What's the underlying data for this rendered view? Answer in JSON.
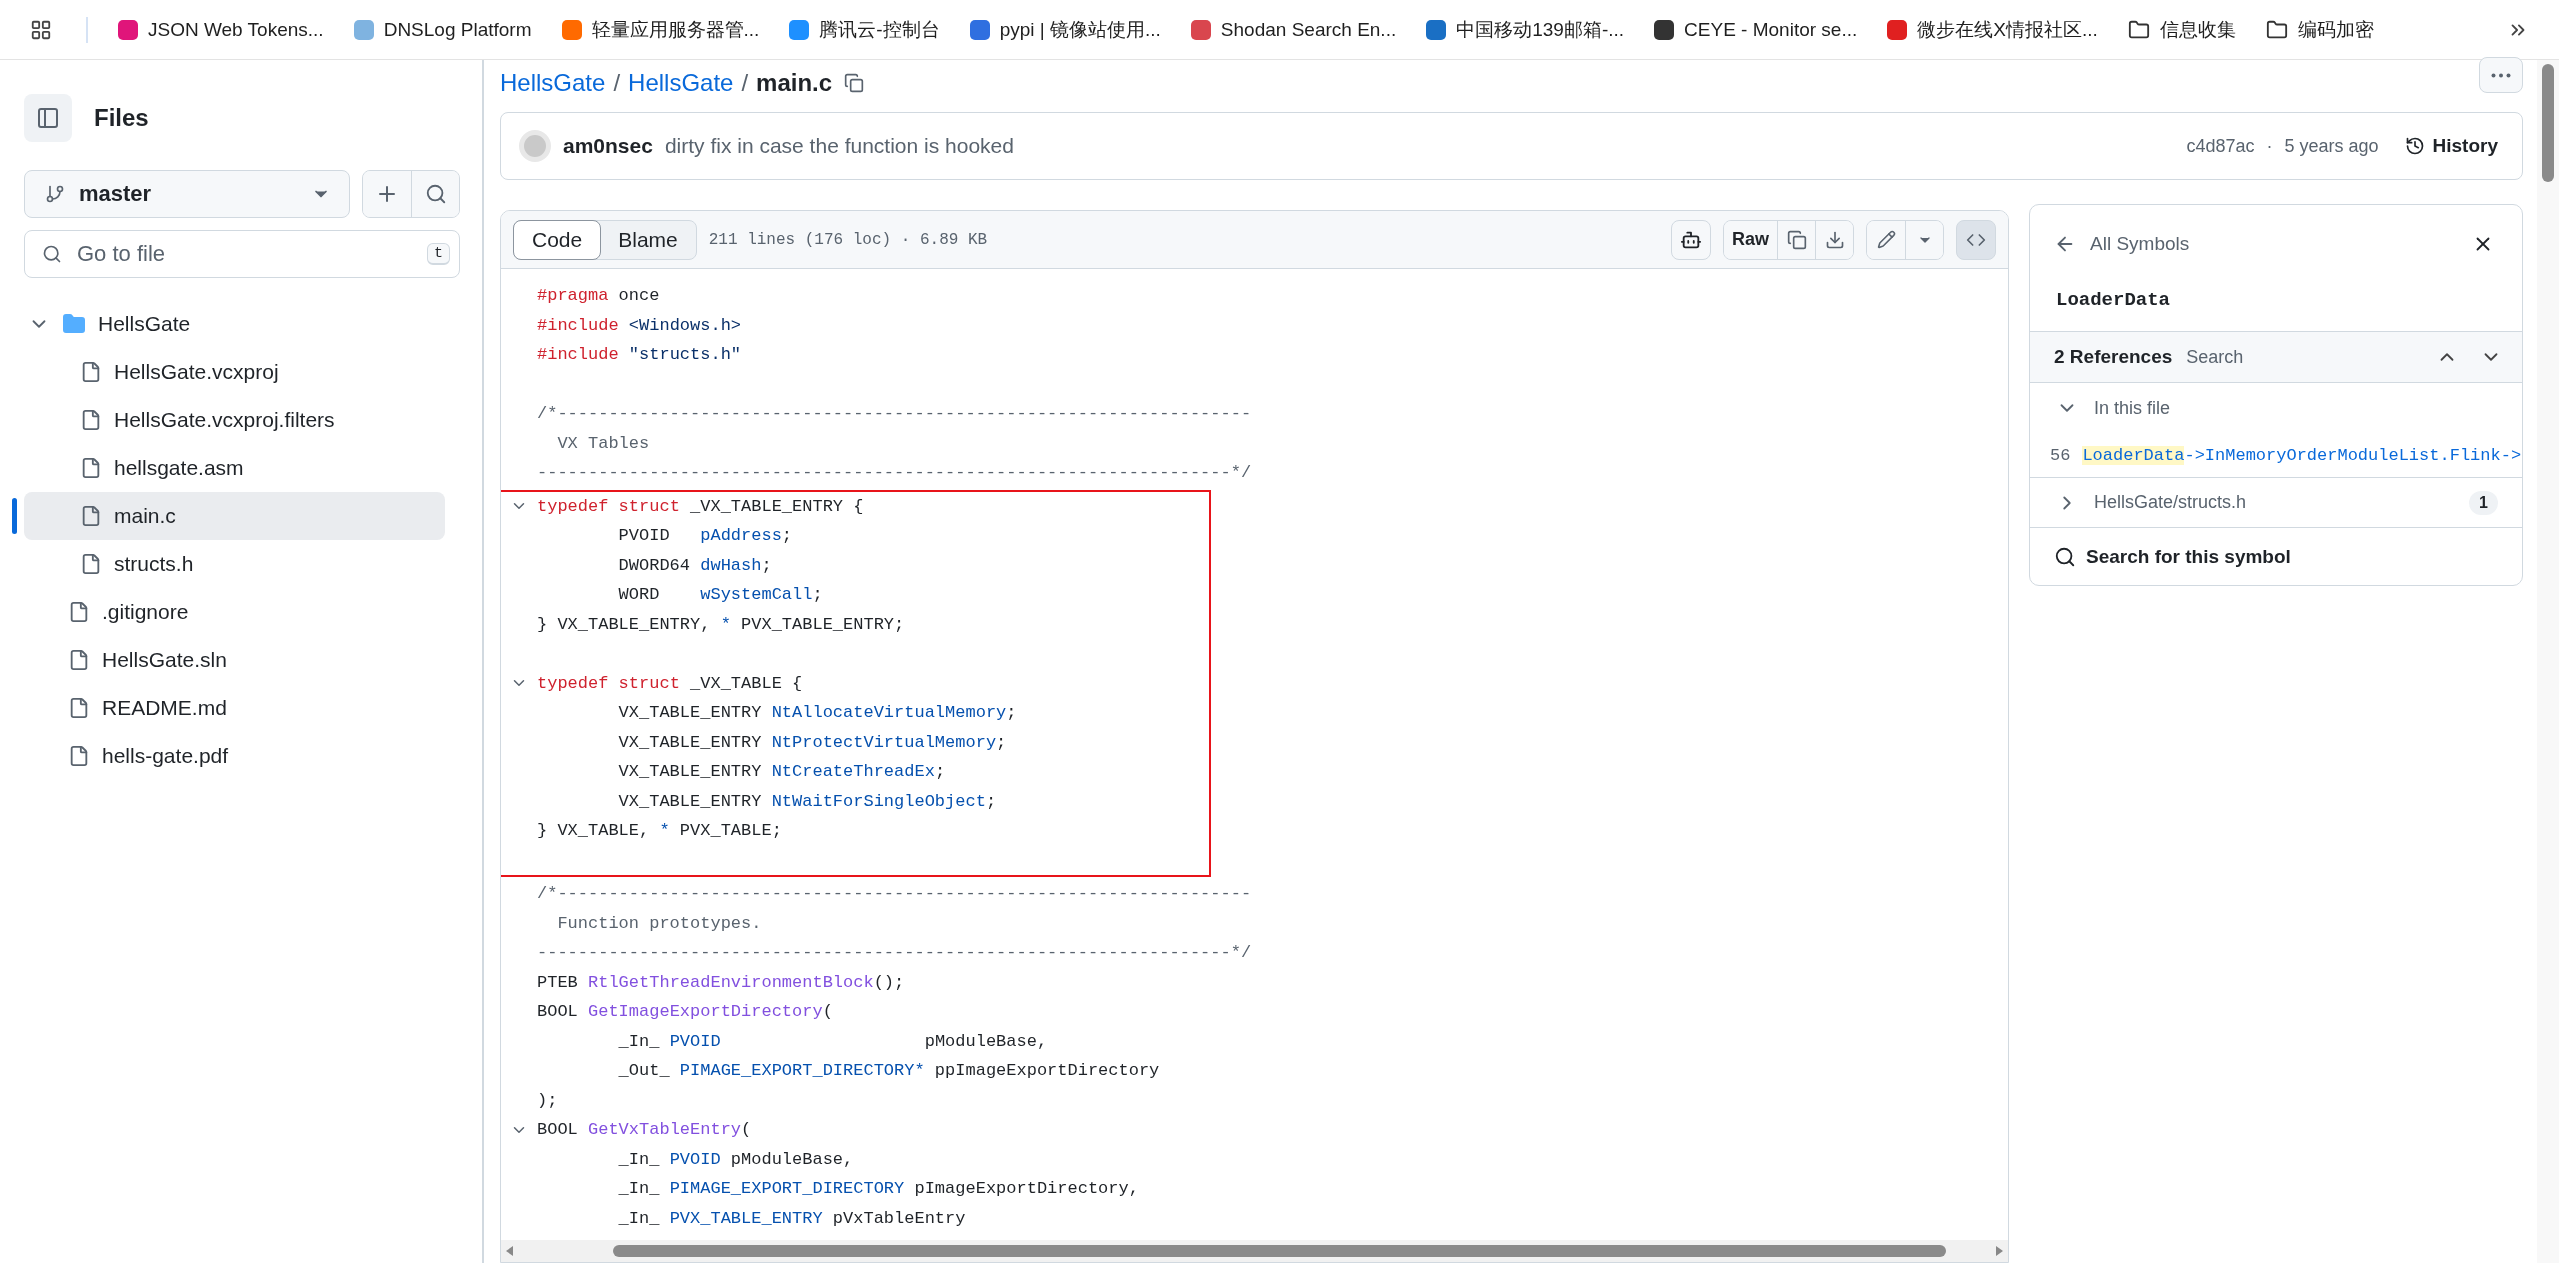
{
  "bookmarks": [
    {
      "kind": "site",
      "label": "JSON Web Tokens...",
      "color": "#e0157a"
    },
    {
      "kind": "site",
      "label": "DNSLog Platform",
      "color": "#7fb3e0"
    },
    {
      "kind": "site",
      "label": "轻量应用服务器管...",
      "color": "#ff6a00"
    },
    {
      "kind": "site",
      "label": "腾讯云-控制台",
      "color": "#1e90ff"
    },
    {
      "kind": "site",
      "label": "pypi | 镜像站使用...",
      "color": "#2f6fe0"
    },
    {
      "kind": "site",
      "label": "Shodan Search En...",
      "color": "#d9464e"
    },
    {
      "kind": "site",
      "label": "中国移动139邮箱-...",
      "color": "#1a6fc4"
    },
    {
      "kind": "site",
      "label": "CEYE - Monitor se...",
      "color": "#333333"
    },
    {
      "kind": "site",
      "label": "微步在线X情报社区...",
      "color": "#e02020"
    },
    {
      "kind": "folder",
      "label": "信息收集"
    },
    {
      "kind": "folder",
      "label": "编码加密"
    }
  ],
  "sidebar": {
    "title": "Files",
    "branch": "master",
    "search": {
      "placeholder": "Go to file",
      "shortcut": "t"
    },
    "tree": [
      {
        "kind": "folder",
        "label": "HellsGate",
        "expanded": true,
        "selected": false,
        "children": [
          {
            "kind": "file",
            "label": "HellsGate.vcxproj",
            "selected": false
          },
          {
            "kind": "file",
            "label": "HellsGate.vcxproj.filters",
            "selected": false
          },
          {
            "kind": "file",
            "label": "hellsgate.asm",
            "selected": false
          },
          {
            "kind": "file",
            "label": "main.c",
            "selected": true
          },
          {
            "kind": "file",
            "label": "structs.h",
            "selected": false
          }
        ]
      },
      {
        "kind": "file",
        "label": ".gitignore",
        "selected": false
      },
      {
        "kind": "file",
        "label": "HellsGate.sln",
        "selected": false
      },
      {
        "kind": "file",
        "label": "README.md",
        "selected": false
      },
      {
        "kind": "file",
        "label": "hells-gate.pdf",
        "selected": false
      }
    ]
  },
  "breadcrumb": [
    {
      "kind": "link",
      "text": "HellsGate"
    },
    {
      "kind": "sep",
      "text": "/"
    },
    {
      "kind": "link",
      "text": "HellsGate"
    },
    {
      "kind": "sep",
      "text": "/"
    },
    {
      "kind": "current",
      "text": "main.c"
    }
  ],
  "commit": {
    "author": "am0nsec",
    "message": "dirty fix in case the function is hooked",
    "sha": "c4d87ac",
    "separator": "·",
    "time": "5 years ago",
    "history": "History"
  },
  "file_header": {
    "tabs": [
      {
        "label": "Code",
        "selected": true
      },
      {
        "label": "Blame",
        "selected": false
      }
    ],
    "info": "211 lines (176 loc) · 6.89 KB",
    "raw": "Raw",
    "symbols_open": true
  },
  "code_blocks": [
    {
      "highlighted": false,
      "lines": [
        {
          "kind": "plain",
          "tokens": [
            {
              "kind": "kw",
              "text": "#pragma"
            },
            {
              "kind": "plain",
              "text": " once"
            }
          ]
        },
        {
          "kind": "plain",
          "tokens": [
            {
              "kind": "kw",
              "text": "#include"
            },
            {
              "kind": "str",
              "text": " <Windows.h>"
            }
          ]
        },
        {
          "kind": "plain",
          "tokens": [
            {
              "kind": "kw",
              "text": "#include"
            },
            {
              "kind": "str",
              "text": " \"structs.h\""
            }
          ]
        },
        {
          "kind": "blank"
        },
        {
          "kind": "plain",
          "tokens": [
            {
              "kind": "comment",
              "text": "/*--------------------------------------------------------------------"
            }
          ]
        },
        {
          "kind": "plain",
          "tokens": [
            {
              "kind": "comment",
              "text": "  VX Tables"
            }
          ]
        },
        {
          "kind": "plain",
          "tokens": [
            {
              "kind": "comment",
              "text": "--------------------------------------------------------------------*/"
            }
          ]
        }
      ]
    },
    {
      "highlighted": true,
      "lines": [
        {
          "kind": "fold",
          "tokens": [
            {
              "kind": "kw",
              "text": "typedef"
            },
            {
              "kind": "kw",
              "text": " struct"
            },
            {
              "kind": "plain",
              "text": " _VX_TABLE_ENTRY {"
            }
          ]
        },
        {
          "kind": "plain",
          "tokens": [
            {
              "kind": "plain",
              "text": "        PVOID   "
            },
            {
              "kind": "entity",
              "text": "pAddress"
            },
            {
              "kind": "plain",
              "text": ";"
            }
          ]
        },
        {
          "kind": "plain",
          "tokens": [
            {
              "kind": "plain",
              "text": "        DWORD64 "
            },
            {
              "kind": "entity",
              "text": "dwHash"
            },
            {
              "kind": "plain",
              "text": ";"
            }
          ]
        },
        {
          "kind": "plain",
          "tokens": [
            {
              "kind": "plain",
              "text": "        WORD    "
            },
            {
              "kind": "entity",
              "text": "wSystemCall"
            },
            {
              "kind": "plain",
              "text": ";"
            }
          ]
        },
        {
          "kind": "plain",
          "tokens": [
            {
              "kind": "plain",
              "text": "} VX_TABLE_ENTRY, "
            },
            {
              "kind": "entity",
              "text": "*"
            },
            {
              "kind": "plain",
              "text": " PVX_TABLE_ENTRY;"
            }
          ]
        },
        {
          "kind": "blank"
        },
        {
          "kind": "fold",
          "tokens": [
            {
              "kind": "kw",
              "text": "typedef"
            },
            {
              "kind": "kw",
              "text": " struct"
            },
            {
              "kind": "plain",
              "text": " _VX_TABLE {"
            }
          ]
        },
        {
          "kind": "plain",
          "tokens": [
            {
              "kind": "plain",
              "text": "        VX_TABLE_ENTRY "
            },
            {
              "kind": "entity",
              "text": "NtAllocateVirtualMemory"
            },
            {
              "kind": "plain",
              "text": ";"
            }
          ]
        },
        {
          "kind": "plain",
          "tokens": [
            {
              "kind": "plain",
              "text": "        VX_TABLE_ENTRY "
            },
            {
              "kind": "entity",
              "text": "NtProtectVirtualMemory"
            },
            {
              "kind": "plain",
              "text": ";"
            }
          ]
        },
        {
          "kind": "plain",
          "tokens": [
            {
              "kind": "plain",
              "text": "        VX_TABLE_ENTRY "
            },
            {
              "kind": "entity",
              "text": "NtCreateThreadEx"
            },
            {
              "kind": "plain",
              "text": ";"
            }
          ]
        },
        {
          "kind": "plain",
          "tokens": [
            {
              "kind": "plain",
              "text": "        VX_TABLE_ENTRY "
            },
            {
              "kind": "entity",
              "text": "NtWaitForSingleObject"
            },
            {
              "kind": "plain",
              "text": ";"
            }
          ]
        },
        {
          "kind": "plain",
          "tokens": [
            {
              "kind": "plain",
              "text": "} VX_TABLE, "
            },
            {
              "kind": "entity",
              "text": "*"
            },
            {
              "kind": "plain",
              "text": " PVX_TABLE;"
            }
          ]
        },
        {
          "kind": "blank"
        }
      ]
    },
    {
      "highlighted": false,
      "lines": [
        {
          "kind": "plain",
          "tokens": [
            {
              "kind": "comment",
              "text": "/*--------------------------------------------------------------------"
            }
          ]
        },
        {
          "kind": "plain",
          "tokens": [
            {
              "kind": "comment",
              "text": "  Function prototypes."
            }
          ]
        },
        {
          "kind": "plain",
          "tokens": [
            {
              "kind": "comment",
              "text": "--------------------------------------------------------------------*/"
            }
          ]
        },
        {
          "kind": "plain",
          "tokens": [
            {
              "kind": "plain",
              "text": "PTEB "
            },
            {
              "kind": "func",
              "text": "RtlGetThreadEnvironmentBlock"
            },
            {
              "kind": "plain",
              "text": "();"
            }
          ]
        },
        {
          "kind": "plain",
          "tokens": [
            {
              "kind": "plain",
              "text": "BOOL "
            },
            {
              "kind": "func",
              "text": "GetImageExportDirectory"
            },
            {
              "kind": "plain",
              "text": "("
            }
          ]
        },
        {
          "kind": "plain",
          "tokens": [
            {
              "kind": "plain",
              "text": "        _In_ "
            },
            {
              "kind": "entity",
              "text": "PVOID"
            },
            {
              "kind": "plain",
              "text": "                    pModuleBase,"
            }
          ]
        },
        {
          "kind": "plain",
          "tokens": [
            {
              "kind": "plain",
              "text": "        _Out_ "
            },
            {
              "kind": "entity",
              "text": "PIMAGE_EXPORT_DIRECTORY*"
            },
            {
              "kind": "plain",
              "text": " ppImageExportDirectory"
            }
          ]
        },
        {
          "kind": "plain",
          "tokens": [
            {
              "kind": "plain",
              "text": ");"
            }
          ]
        },
        {
          "kind": "fold",
          "tokens": [
            {
              "kind": "plain",
              "text": "BOOL "
            },
            {
              "kind": "func",
              "text": "GetVxTableEntry"
            },
            {
              "kind": "plain",
              "text": "("
            }
          ]
        },
        {
          "kind": "plain",
          "tokens": [
            {
              "kind": "plain",
              "text": "        _In_ "
            },
            {
              "kind": "entity",
              "text": "PVOID"
            },
            {
              "kind": "plain",
              "text": " pModuleBase,"
            }
          ]
        },
        {
          "kind": "plain",
          "tokens": [
            {
              "kind": "plain",
              "text": "        _In_ "
            },
            {
              "kind": "entity",
              "text": "PIMAGE_EXPORT_DIRECTORY"
            },
            {
              "kind": "plain",
              "text": " pImageExportDirectory,"
            }
          ]
        },
        {
          "kind": "plain",
          "tokens": [
            {
              "kind": "plain",
              "text": "        _In_ "
            },
            {
              "kind": "entity",
              "text": "PVX_TABLE_ENTRY"
            },
            {
              "kind": "plain",
              "text": " pVxTableEntry"
            }
          ]
        }
      ]
    }
  ],
  "symbols": {
    "back": "All Symbols",
    "symbol": "LoaderData",
    "references": "2 References",
    "search": "Search",
    "groups": [
      {
        "label": "In this file",
        "expanded": true,
        "refs": [
          {
            "line": "56",
            "match": "LoaderData",
            "rest": "->InMemoryOrderModuleList.Flink->"
          }
        ]
      },
      {
        "label": "HellsGate/structs.h",
        "expanded": false,
        "count": "1"
      }
    ],
    "search_symbol": "Search for this symbol"
  }
}
